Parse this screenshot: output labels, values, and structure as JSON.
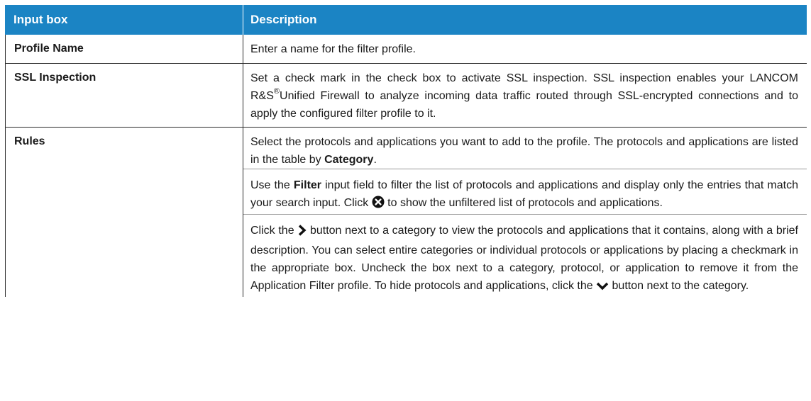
{
  "header": {
    "col1": "Input box",
    "col2": "Description"
  },
  "rows": {
    "profile_name": {
      "label": "Profile Name",
      "desc": "Enter a name for the filter profile."
    },
    "ssl": {
      "label": "SSL Inspection",
      "desc_a": "Set a check mark in the check box to activate SSL inspection. SSL inspection enables your LANCOM R&S",
      "reg": "®",
      "desc_b": "Unified Firewall to analyze incoming data traffic routed through SSL-encrypted connections and to apply the configured filter profile to it."
    },
    "rules": {
      "label": "Rules",
      "p1_a": "Select the protocols and applications you want to add to the profile. The protocols and applications are listed in the table by ",
      "p1_bold": "Category",
      "p1_b": ".",
      "p2_a": "Use the ",
      "p2_bold": "Filter",
      "p2_b": " input field to filter the list of protocols and applications and display only the entries that match your search input. Click ",
      "p2_c": " to show the unfiltered list of protocols and applications.",
      "p3_a": "Click the ",
      "p3_b": " button next to a category to view the protocols and applications that it contains, along with a brief description. You can select entire categories or individual protocols or applications by placing a checkmark in the appropriate box. Uncheck the box next to a category, protocol, or application to remove it from the Application Filter profile. To hide protocols and applications, click the ",
      "p3_c": " button next to the category."
    }
  },
  "colors": {
    "header_bg": "#1b84c4",
    "header_text": "#ffffff"
  }
}
